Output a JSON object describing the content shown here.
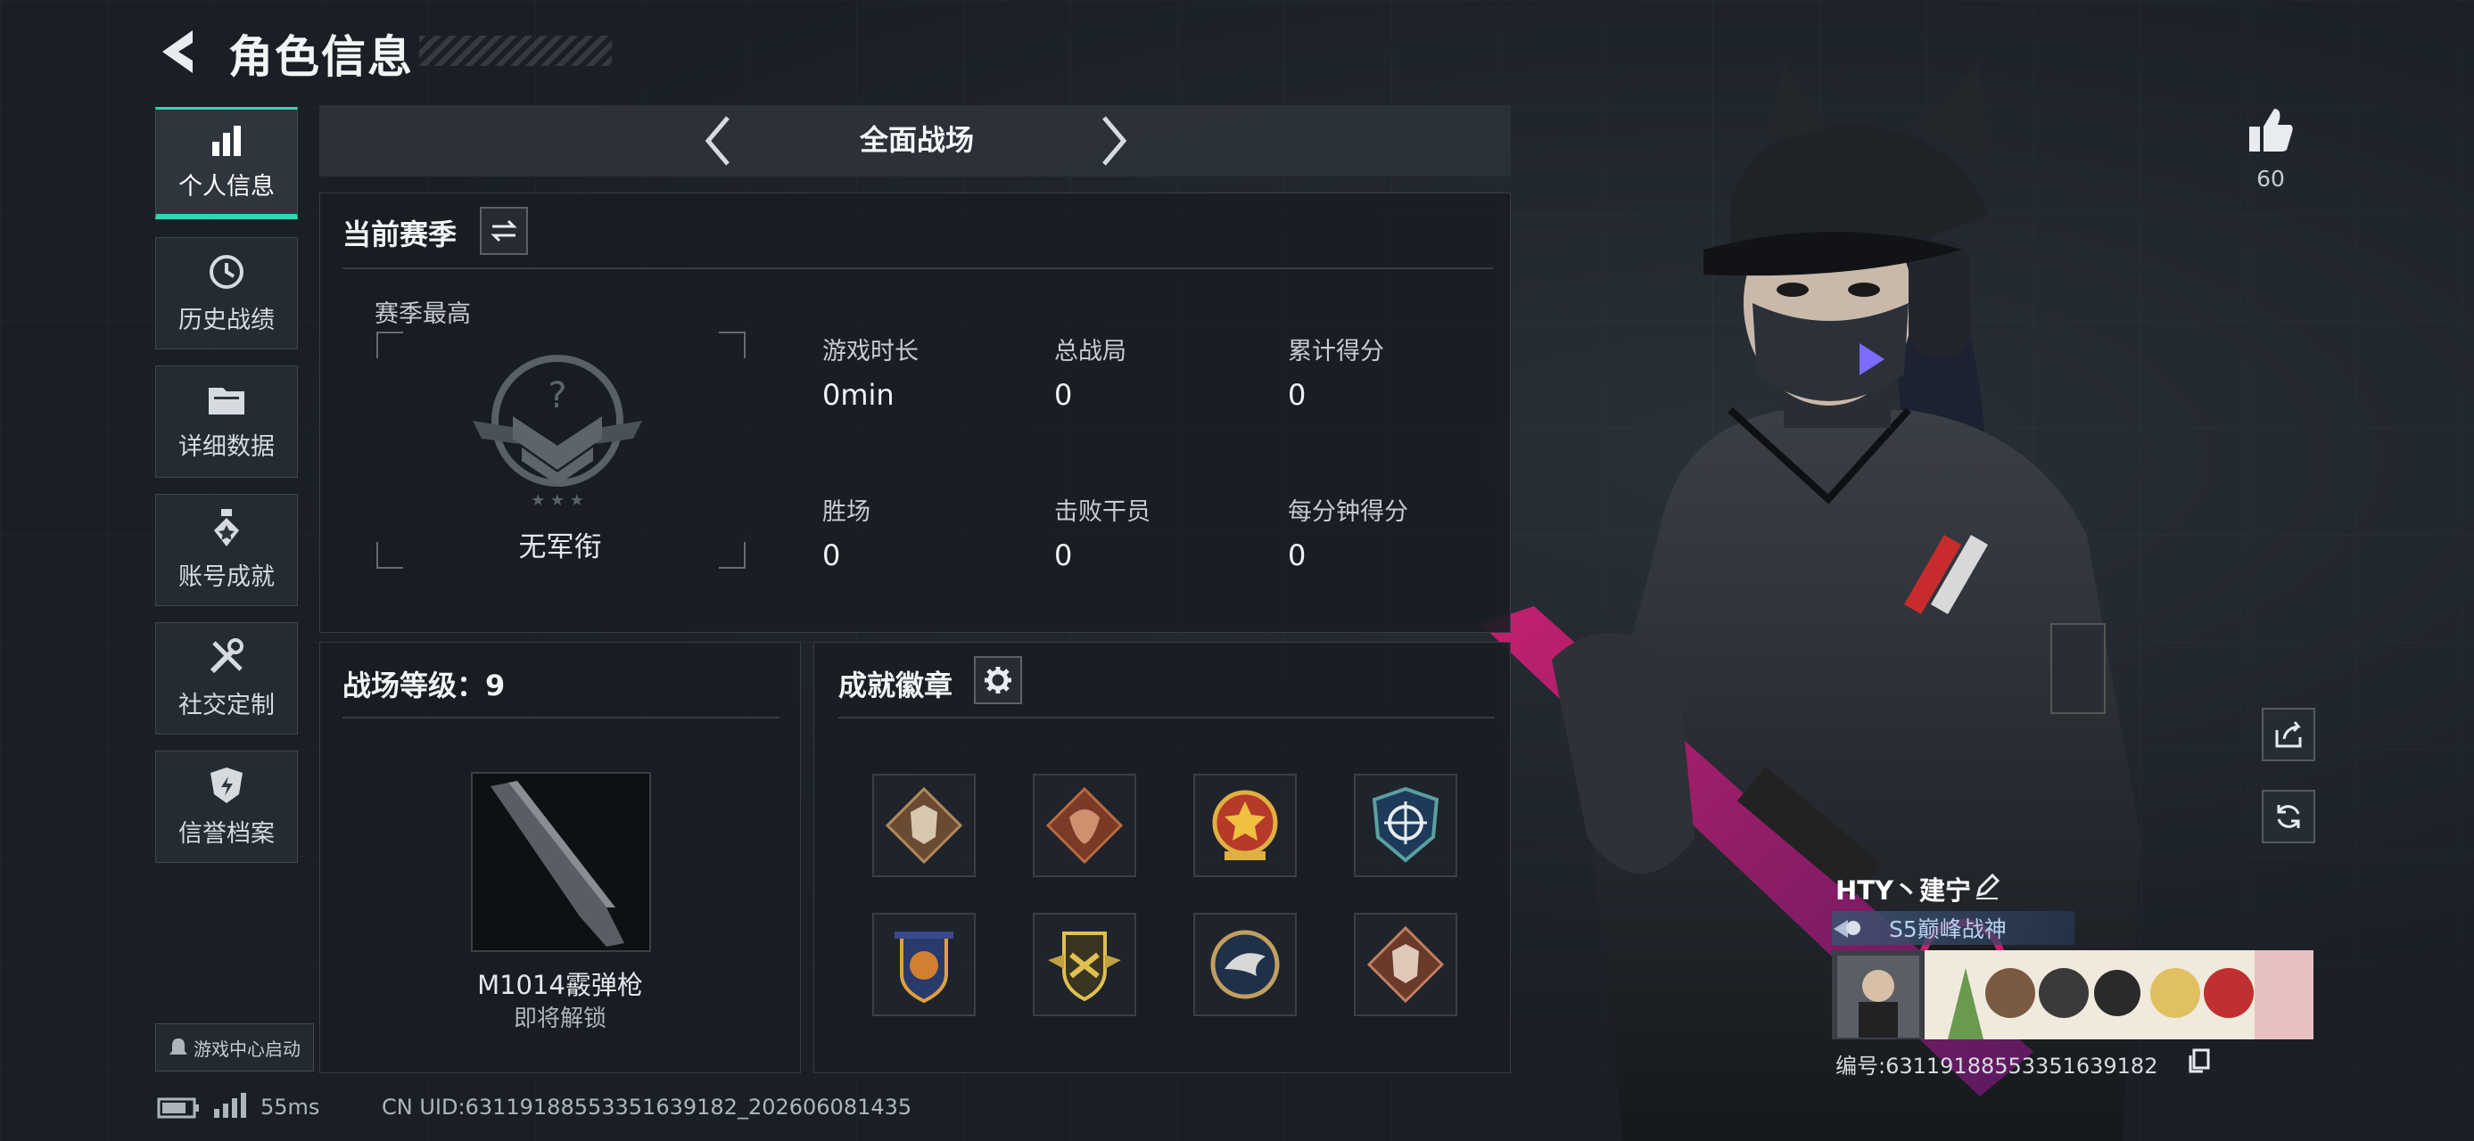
{
  "header": {
    "title": "角色信息"
  },
  "nav": [
    {
      "label": "个人信息",
      "active": true
    },
    {
      "label": "历史战绩"
    },
    {
      "label": "详细数据"
    },
    {
      "label": "账号成就"
    },
    {
      "label": "社交定制"
    },
    {
      "label": "信誉档案"
    }
  ],
  "mode_selector": {
    "label": "全面战场"
  },
  "season": {
    "title": "当前赛季",
    "best_label": "赛季最高",
    "rank_name": "无军衔",
    "stats": [
      {
        "label": "游戏时长",
        "value": "0min"
      },
      {
        "label": "总战局",
        "value": "0"
      },
      {
        "label": "累计得分",
        "value": "0"
      },
      {
        "label": "胜场",
        "value": "0"
      },
      {
        "label": "击败干员",
        "value": "0"
      },
      {
        "label": "每分钟得分",
        "value": "0"
      }
    ]
  },
  "battlefield_level": {
    "title": "战场等级：9",
    "weapon_name": "M1014霰弹枪",
    "weapon_status": "即将解锁"
  },
  "achievements": {
    "title": "成就徽章"
  },
  "game_center": {
    "label": "游戏中心启动"
  },
  "status_bar": {
    "ping": "55ms",
    "uid": "CN UID:6311918855335163918​2_202606081435"
  },
  "profile": {
    "likes": "60",
    "player_name": "HTY丶建宁",
    "title_badge": "S5巅峰战神",
    "id_number": "编号:6311918855335163918​2"
  },
  "colors": {
    "accent": "#2ad9b0",
    "background": "#1a1f26",
    "panel": "#181d24"
  }
}
